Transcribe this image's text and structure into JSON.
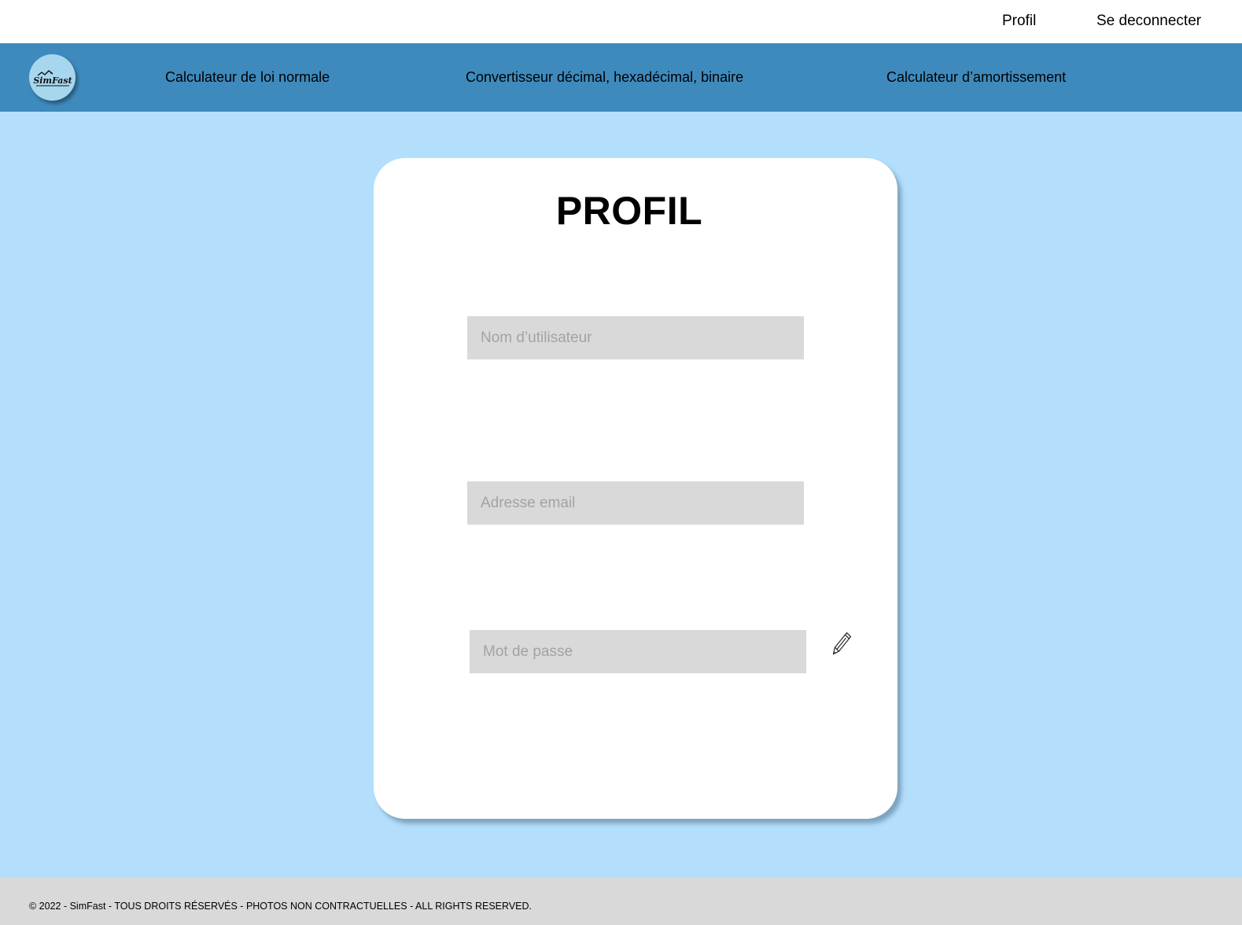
{
  "topbar": {
    "profile_link": "Profil",
    "logout_link": "Se deconnecter"
  },
  "navbar": {
    "logo_text": "SimFast",
    "links": [
      "Calculateur de loi normale",
      "Convertisseur décimal, hexadécimal, binaire",
      "Calculateur d’amortissement"
    ]
  },
  "card": {
    "title": "PROFIL",
    "fields": {
      "username_placeholder": "Nom d’utilisateur",
      "email_placeholder": "Adresse email",
      "password_placeholder": "Mot de passe"
    },
    "edit_icon": "pencil-icon"
  },
  "footer": {
    "text": "© 2022 - SimFast - TOUS DROITS RÉSERVÉS - PHOTOS NON CONTRACTUELLES - ALL RIGHTS RESERVED."
  },
  "colors": {
    "page_background": "#b3dffd",
    "navbar": "#3e8abd",
    "logo_circle": "#a6d7ee",
    "input_fill": "#d9d9d9",
    "footer": "#d9d9d9"
  }
}
